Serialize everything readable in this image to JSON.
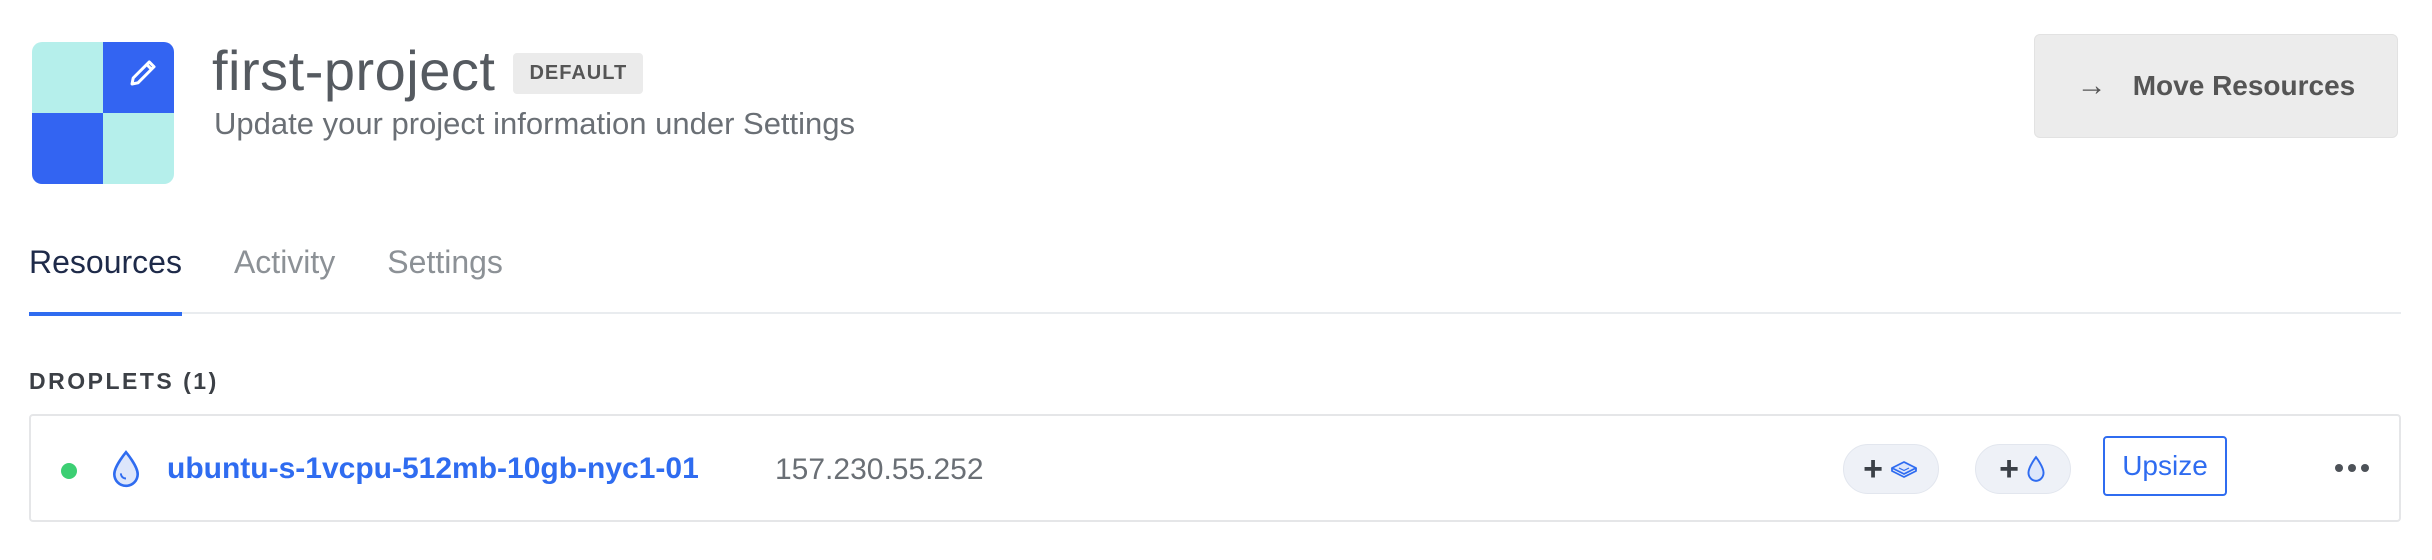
{
  "project": {
    "name": "first-project",
    "badge": "DEFAULT",
    "subtitle": "Update your project information under Settings",
    "icon_colors": {
      "light": "#b5efeb",
      "blue": "#3364f2"
    }
  },
  "header": {
    "move_resources_label": "Move Resources",
    "move_resources_icon": "arrow-right-icon"
  },
  "tabs": [
    {
      "label": "Resources",
      "active": true
    },
    {
      "label": "Activity",
      "active": false
    },
    {
      "label": "Settings",
      "active": false
    }
  ],
  "droplets": {
    "section_label": "DROPLETS (1)",
    "items": [
      {
        "status": "active",
        "status_color": "#3ccf73",
        "name": "ubuntu-s-1vcpu-512mb-10gb-nyc1-01",
        "ip": "157.230.55.252",
        "actions": {
          "add_volume_icon": "volume-icon",
          "add_floating_ip_icon": "droplet-icon",
          "upsize_label": "Upsize",
          "more_icon": "more-icon"
        }
      }
    ]
  },
  "colors": {
    "accent": "#2f6cf0",
    "tab_active_text": "#1e2a49"
  }
}
